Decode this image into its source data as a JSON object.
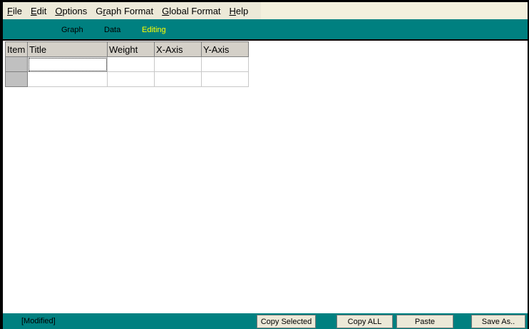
{
  "menu": {
    "items": [
      {
        "accel": "F",
        "rest": "ile"
      },
      {
        "accel": "E",
        "rest": "dit"
      },
      {
        "accel": "O",
        "rest": "ptions"
      },
      {
        "pre": "G",
        "accel": "r",
        "rest": "aph Format"
      },
      {
        "accel": "G",
        "rest": "lobal Format"
      },
      {
        "accel": "H",
        "rest": "elp"
      }
    ]
  },
  "tabs": {
    "graph": "Graph",
    "data": "Data",
    "editing": "Editing",
    "active": "editing"
  },
  "grid": {
    "headers": {
      "item": "Item",
      "title": "Title",
      "weight": "Weight",
      "xaxis": "X-Axis",
      "yaxis": "Y-Axis"
    },
    "rows": [
      {
        "title": "",
        "weight": "",
        "xaxis": "",
        "yaxis": ""
      },
      {
        "title": "",
        "weight": "",
        "xaxis": "",
        "yaxis": ""
      }
    ]
  },
  "status": {
    "text": "[Modified]",
    "buttons": {
      "copy_selected": "Copy Selected",
      "copy_all": "Copy ALL",
      "paste": "Paste",
      "save_as": "Save As.."
    }
  },
  "colors": {
    "teal": "#008080",
    "active_tab": "#ffff00",
    "menu_bg": "#ece9d8"
  }
}
